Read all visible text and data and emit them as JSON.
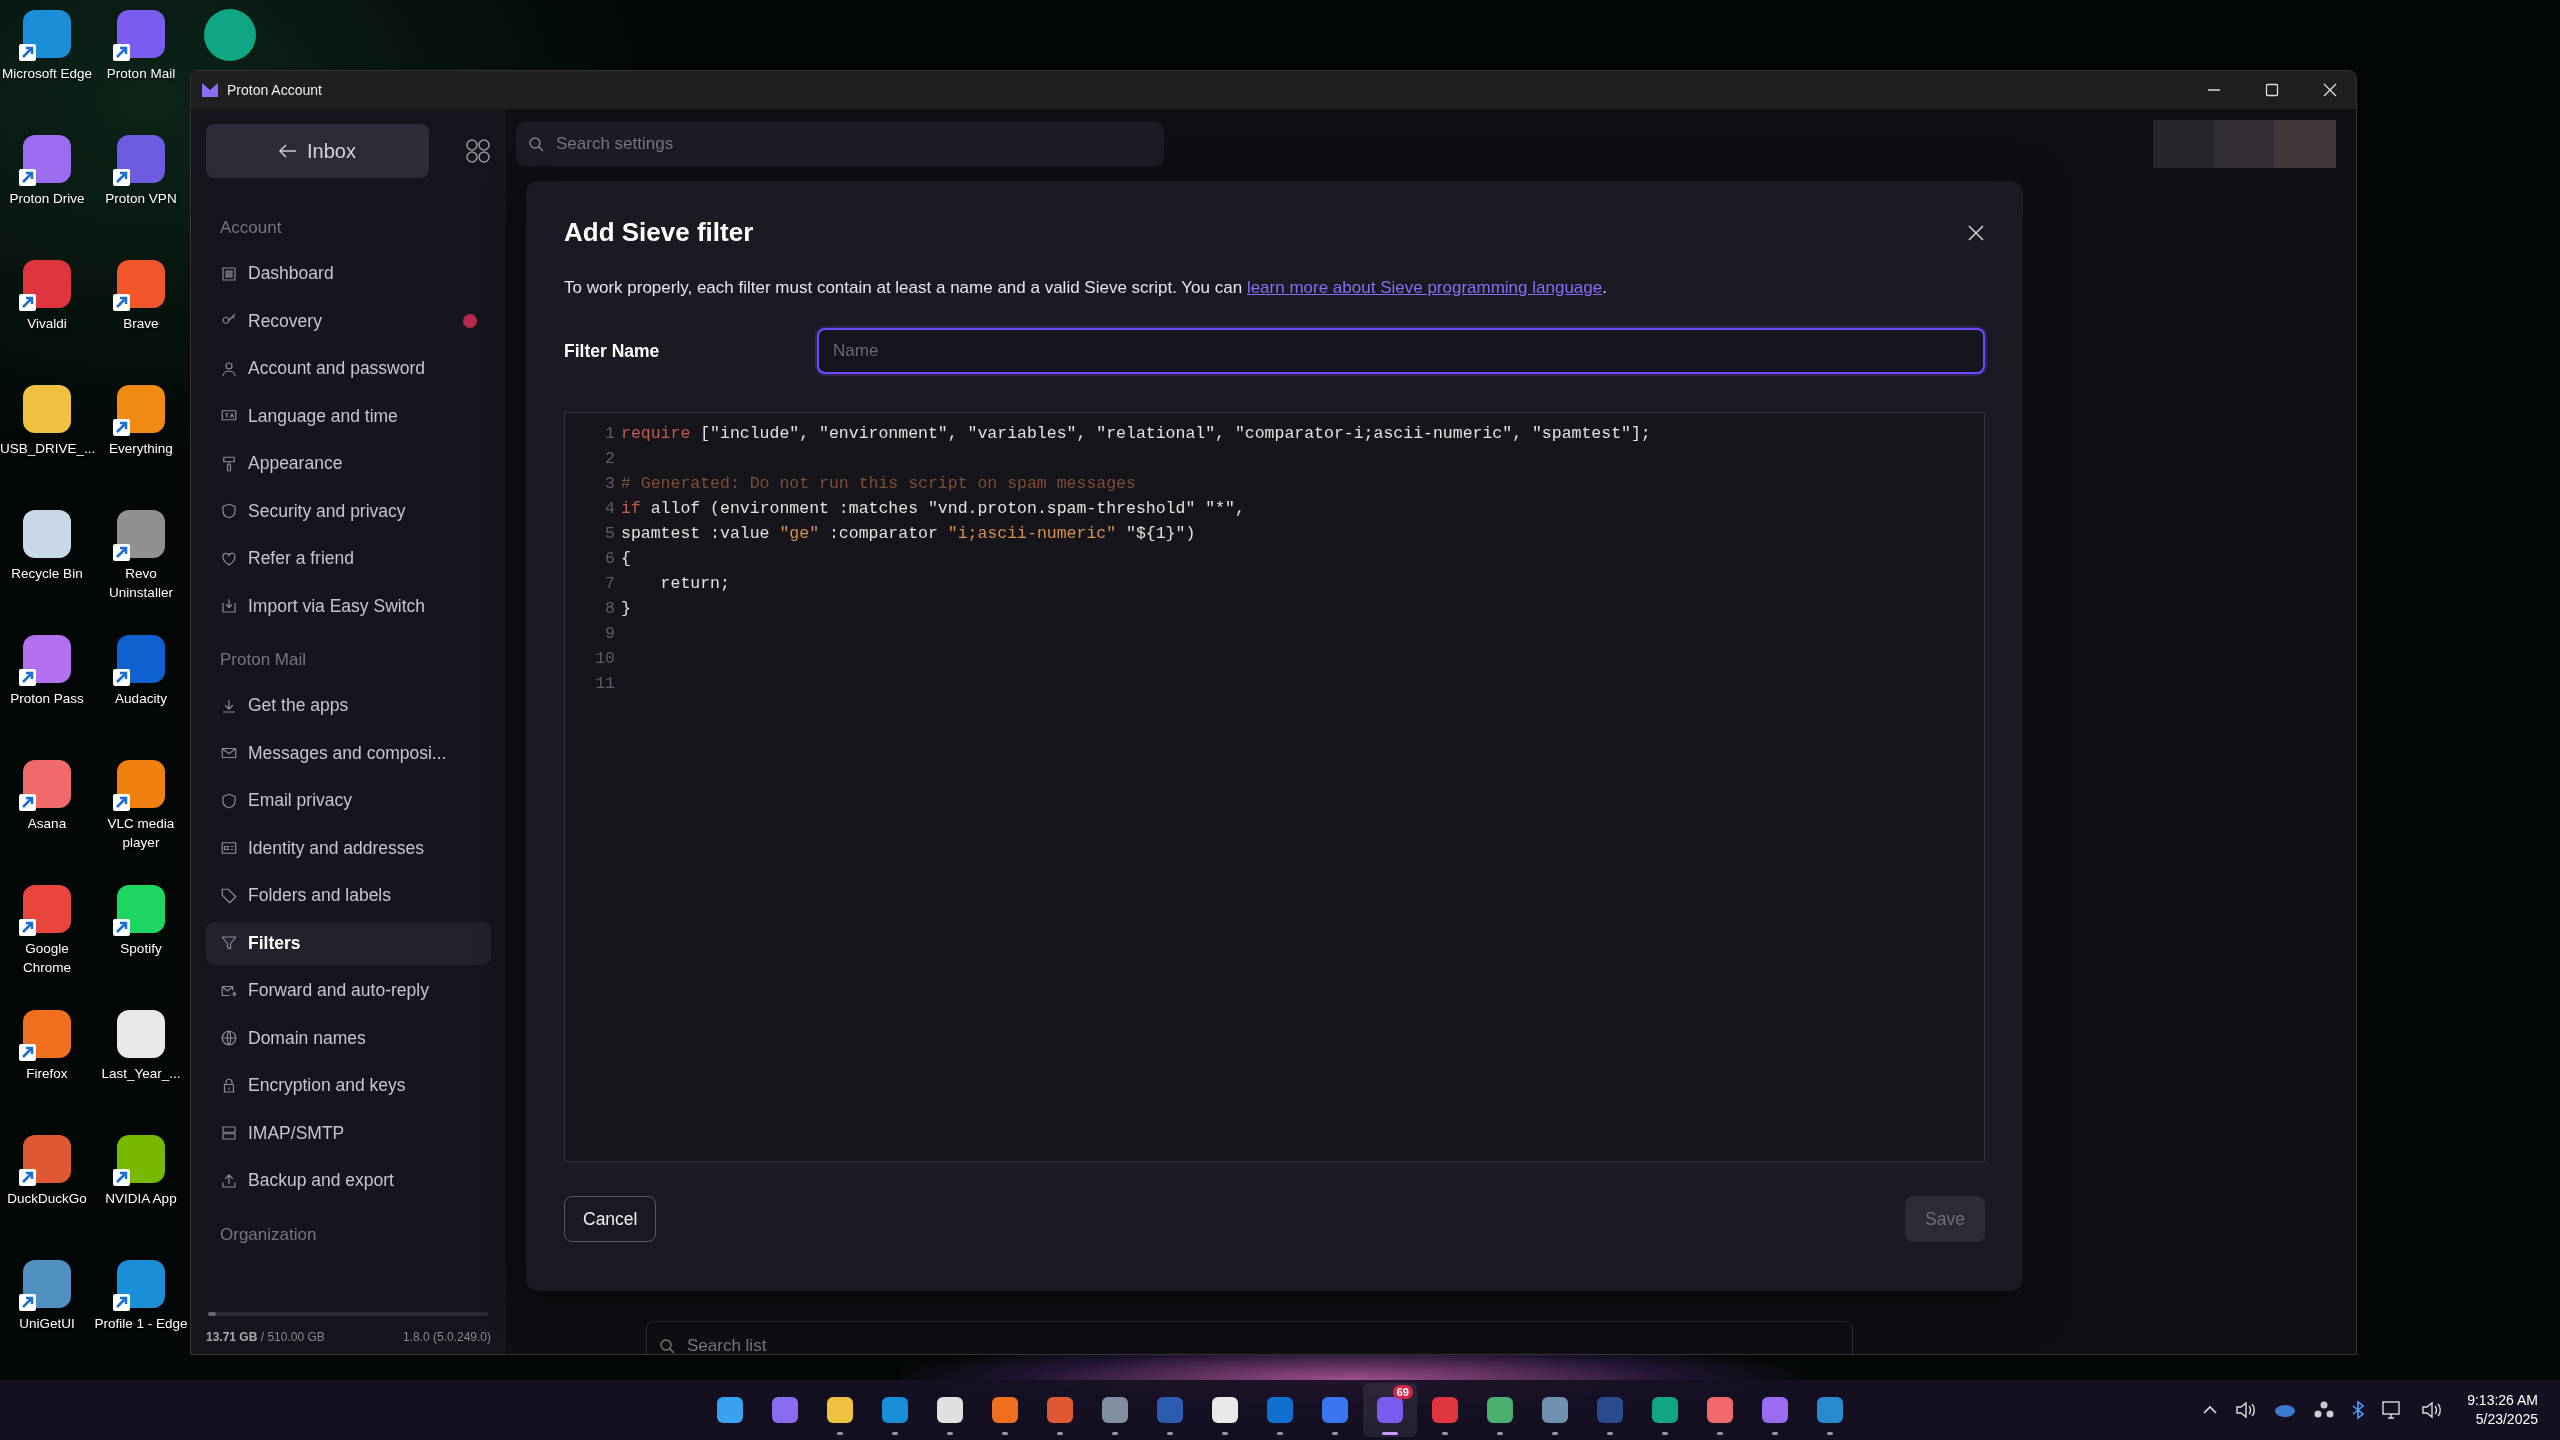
{
  "desktop_icons": [
    {
      "label": "Microsoft Edge",
      "color": "#1a8fd8",
      "shortcut": true
    },
    {
      "label": "Proton Mail",
      "color": "#7b5cf0",
      "shortcut": true
    },
    {
      "label": "Proton Drive",
      "color": "#9b6cf0",
      "shortcut": true
    },
    {
      "label": "Proton VPN",
      "color": "#6e5ce0",
      "shortcut": true
    },
    {
      "label": "Vivaldi",
      "color": "#e0343e",
      "shortcut": true
    },
    {
      "label": "Brave",
      "color": "#f0562a",
      "shortcut": true
    },
    {
      "label": "USB_DRIVE_...",
      "color": "#f0c040",
      "shortcut": false
    },
    {
      "label": "Everything",
      "color": "#f08a10",
      "shortcut": true
    },
    {
      "label": "Recycle Bin",
      "color": "#c8d8e8",
      "shortcut": false
    },
    {
      "label": "Revo Uninstaller",
      "color": "#909090",
      "shortcut": true
    },
    {
      "label": "Proton Pass",
      "color": "#b070f0",
      "shortcut": true
    },
    {
      "label": "Audacity",
      "color": "#1060d0",
      "shortcut": true
    },
    {
      "label": "Asana",
      "color": "#f06a6a",
      "shortcut": true
    },
    {
      "label": "VLC media player",
      "color": "#f08010",
      "shortcut": true
    },
    {
      "label": "Google Chrome",
      "color": "#e8453c",
      "shortcut": true
    },
    {
      "label": "Spotify",
      "color": "#1ed760",
      "shortcut": true
    },
    {
      "label": "Firefox",
      "color": "#f07020",
      "shortcut": true
    },
    {
      "label": "Last_Year_...",
      "color": "#e8e8e8",
      "shortcut": false
    },
    {
      "label": "DuckDuckGo",
      "color": "#de5833",
      "shortcut": true
    },
    {
      "label": "NVIDIA App",
      "color": "#76b900",
      "shortcut": true
    },
    {
      "label": "UniGetUI",
      "color": "#5090c0",
      "shortcut": true
    },
    {
      "label": "Profile 1 - Edge",
      "color": "#1a8fd8",
      "shortcut": true
    }
  ],
  "window": {
    "title": "Proton Account"
  },
  "sidebar": {
    "back_button": "Inbox",
    "sections": [
      {
        "heading": "Account",
        "items": [
          {
            "label": "Dashboard",
            "selected": false,
            "alert": false
          },
          {
            "label": "Recovery",
            "selected": false,
            "alert": true
          },
          {
            "label": "Account and password",
            "selected": false,
            "alert": false
          },
          {
            "label": "Language and time",
            "selected": false,
            "alert": false
          },
          {
            "label": "Appearance",
            "selected": false,
            "alert": false
          },
          {
            "label": "Security and privacy",
            "selected": false,
            "alert": false
          },
          {
            "label": "Refer a friend",
            "selected": false,
            "alert": false
          },
          {
            "label": "Import via Easy Switch",
            "selected": false,
            "alert": false
          }
        ]
      },
      {
        "heading": "Proton Mail",
        "items": [
          {
            "label": "Get the apps",
            "selected": false,
            "alert": false
          },
          {
            "label": "Messages and composi...",
            "selected": false,
            "alert": false
          },
          {
            "label": "Email privacy",
            "selected": false,
            "alert": false
          },
          {
            "label": "Identity and addresses",
            "selected": false,
            "alert": false
          },
          {
            "label": "Folders and labels",
            "selected": false,
            "alert": false
          },
          {
            "label": "Filters",
            "selected": true,
            "alert": false
          },
          {
            "label": "Forward and auto-reply",
            "selected": false,
            "alert": false
          },
          {
            "label": "Domain names",
            "selected": false,
            "alert": false
          },
          {
            "label": "Encryption and keys",
            "selected": false,
            "alert": false
          },
          {
            "label": "IMAP/SMTP",
            "selected": false,
            "alert": false
          },
          {
            "label": "Backup and export",
            "selected": false,
            "alert": false
          }
        ]
      },
      {
        "heading": "Organization"
      }
    ],
    "storage": {
      "level": 0.03,
      "used": "13.71 GB",
      "total": " / 510.00 GB",
      "version": "1.8.0 (5.0.249.0)"
    }
  },
  "search": {
    "placeholder": "Search settings"
  },
  "dialog": {
    "title": "Add Sieve filter",
    "description": "To work properly, each filter must contain at least a name and a valid Sieve script. You can ",
    "link": "learn more about Sieve programming language",
    "description_end": ".",
    "name_label": "Filter Name",
    "name_placeholder": "Name",
    "code_lines": [
      {
        "number": "1",
        "tokens": [
          {
            "kind": "keyword",
            "text": "require"
          },
          {
            "kind": "plain",
            "text": " [\"include\", \"environment\", \"variables\", \"relational\", \"comparator-i;ascii-numeric\", \"spamtest\"];"
          }
        ]
      },
      {
        "number": "2"
      },
      {
        "number": "3",
        "tokens": [
          {
            "kind": "comment",
            "text": "# Generated: Do not run this script on spam messages"
          }
        ]
      },
      {
        "number": "4",
        "tokens": [
          {
            "kind": "keyword",
            "text": "if"
          },
          {
            "kind": "plain",
            "text": " allof (environment :matches \"vnd.proton.spam-threshold\" \"*\","
          }
        ]
      },
      {
        "number": "5",
        "tokens": [
          {
            "kind": "plain",
            "text": "spamtest :value "
          },
          {
            "kind": "string",
            "text": "\"ge\""
          },
          {
            "kind": "plain",
            "text": " :comparator "
          },
          {
            "kind": "string",
            "text": "\"i;ascii-numeric\""
          },
          {
            "kind": "plain",
            "text": " \"${1}\")"
          }
        ]
      },
      {
        "number": "6",
        "tokens": [
          {
            "kind": "plain",
            "text": "{"
          }
        ]
      },
      {
        "number": "7",
        "tokens": [
          {
            "kind": "plain",
            "text": "    return;"
          }
        ]
      },
      {
        "number": "8",
        "tokens": [
          {
            "kind": "plain",
            "text": "}"
          }
        ]
      },
      {
        "number": "9"
      },
      {
        "number": "10"
      },
      {
        "number": "11"
      }
    ],
    "cancel": "Cancel",
    "save": "Save",
    "save_disabled": true
  },
  "list_search": {
    "placeholder": "Search list"
  },
  "taskbar": {
    "apps": [
      {
        "color": "#3aa0f0",
        "running": false,
        "selected": false
      },
      {
        "color": "#8a6cf0",
        "running": false,
        "selected": false
      },
      {
        "color": "#f0c040",
        "running": true,
        "selected": false
      },
      {
        "color": "#1a8fd8",
        "running": true,
        "selected": false
      },
      {
        "color": "#e0e0e0",
        "running": true,
        "selected": false
      },
      {
        "color": "#f07020",
        "running": true,
        "selected": false
      },
      {
        "color": "#de5833",
        "running": true,
        "selected": false
      },
      {
        "color": "#8090a0",
        "running": true,
        "selected": false
      },
      {
        "color": "#2b5cb0",
        "running": true,
        "selected": false
      },
      {
        "color": "#e8e8e8",
        "running": true,
        "selected": false
      },
      {
        "color": "#1070d0",
        "running": true,
        "selected": false
      },
      {
        "color": "#3a76f0",
        "running": true,
        "selected": false
      },
      {
        "color": "#7b5cf0",
        "running": true,
        "selected": true,
        "badge": "69"
      },
      {
        "color": "#e0343e",
        "running": true,
        "selected": false
      },
      {
        "color": "#4ab070",
        "running": true,
        "selected": false
      },
      {
        "color": "#7090b0",
        "running": true,
        "selected": false
      },
      {
        "color": "#2a4a90",
        "running": true,
        "selected": false
      },
      {
        "color": "#11a683",
        "running": true,
        "selected": false
      },
      {
        "color": "#f06a6a",
        "running": true,
        "selected": false
      },
      {
        "color": "#9b6cf0",
        "running": true,
        "selected": false
      },
      {
        "color": "#2a8ad0",
        "running": true,
        "selected": false
      }
    ],
    "time": "9:13:26 AM",
    "date": "5/23/2025"
  }
}
